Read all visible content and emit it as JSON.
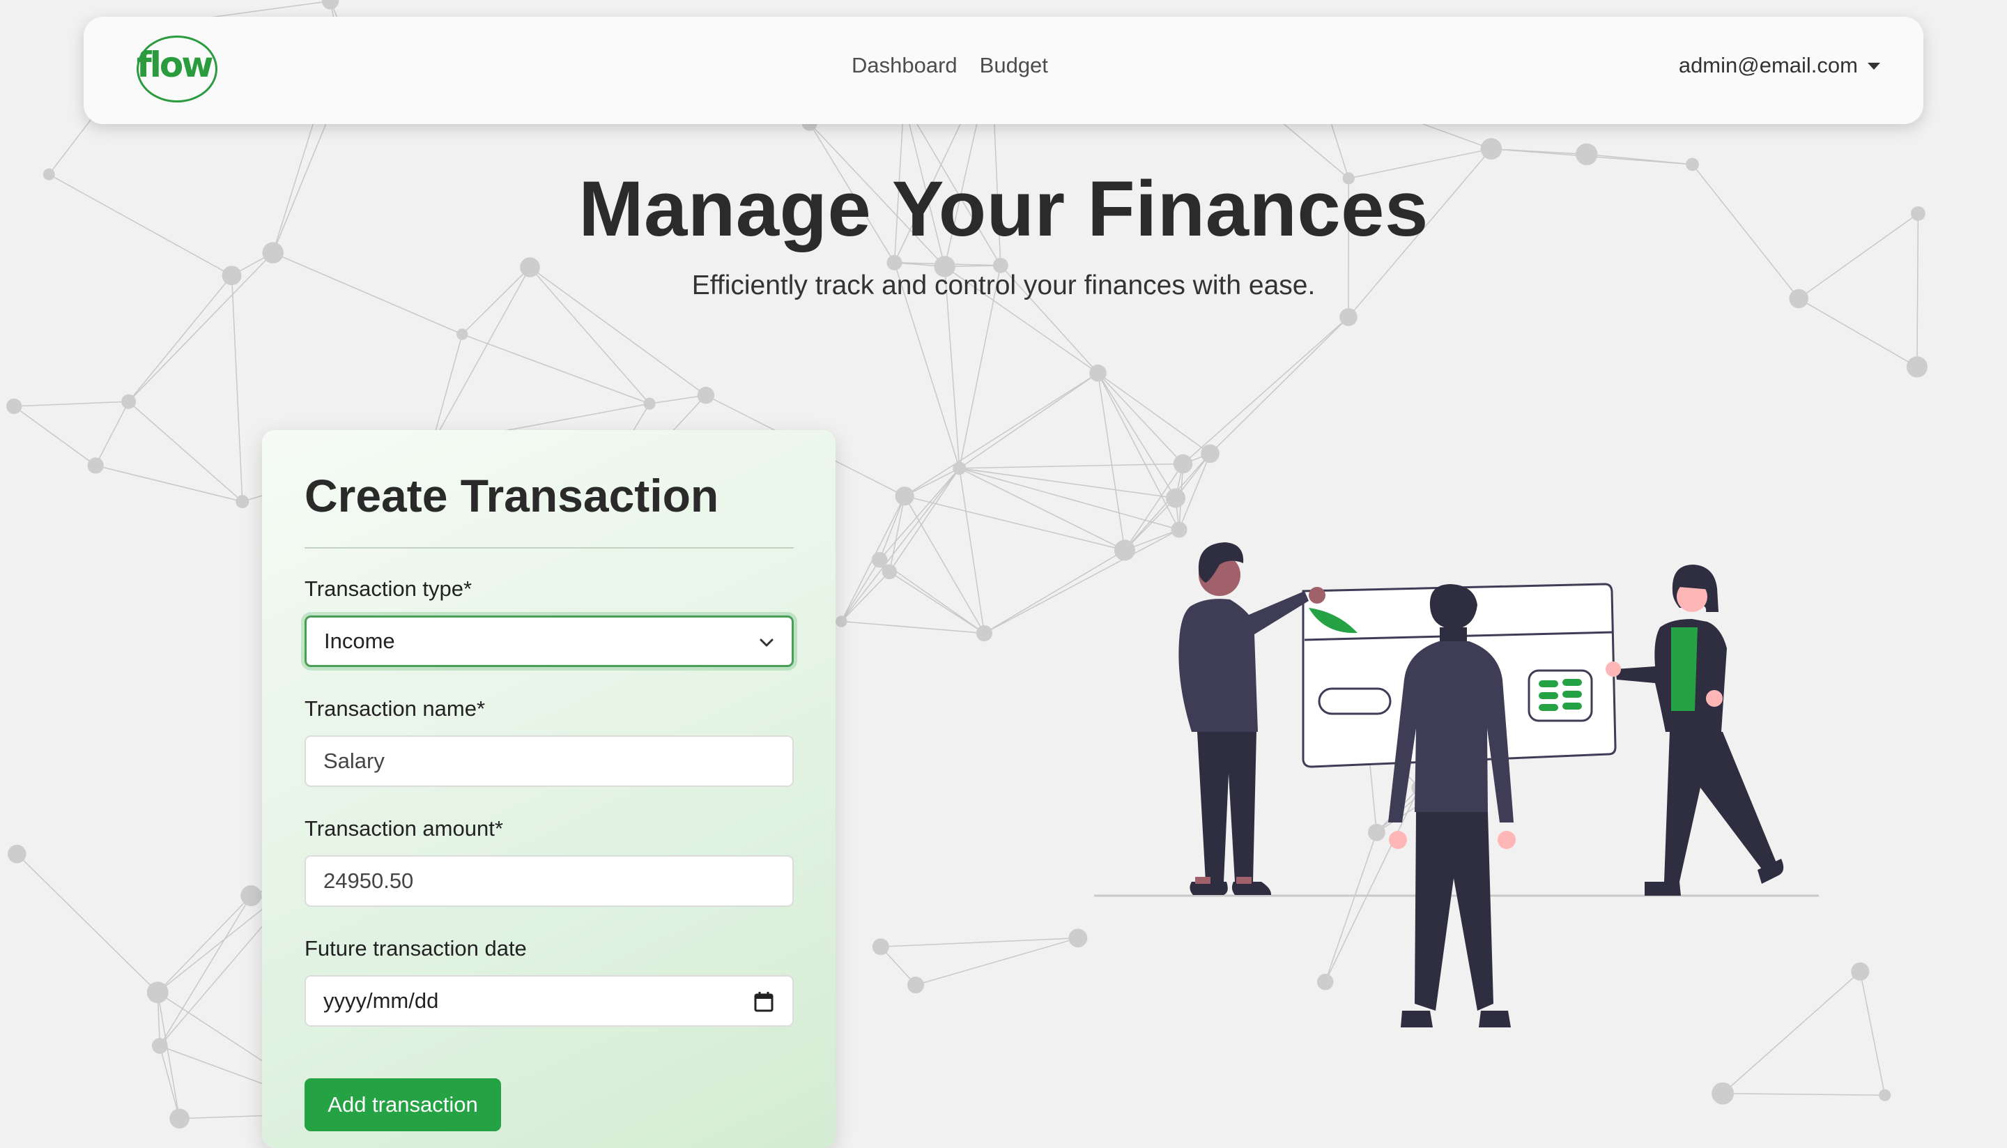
{
  "navbar": {
    "logo_text": "flow",
    "links": [
      "Dashboard",
      "Budget"
    ],
    "user_email": "admin@email.com"
  },
  "hero": {
    "title": "Manage Your Finances",
    "subtitle": "Efficiently track and control your finances with ease."
  },
  "form": {
    "title": "Create Transaction",
    "type_label": "Transaction type*",
    "type_value": "Income",
    "name_label": "Transaction name*",
    "name_value": "Salary",
    "amount_label": "Transaction amount*",
    "amount_value": "24950.50",
    "date_label": "Future transaction date",
    "date_placeholder": "yyyy/mm/dd",
    "submit_label": "Add transaction"
  },
  "colors": {
    "accent": "#25a244",
    "logo": "#2a9c3e",
    "figure_dark": "#2f2e41",
    "figure_skin": "#ffb6b6"
  }
}
